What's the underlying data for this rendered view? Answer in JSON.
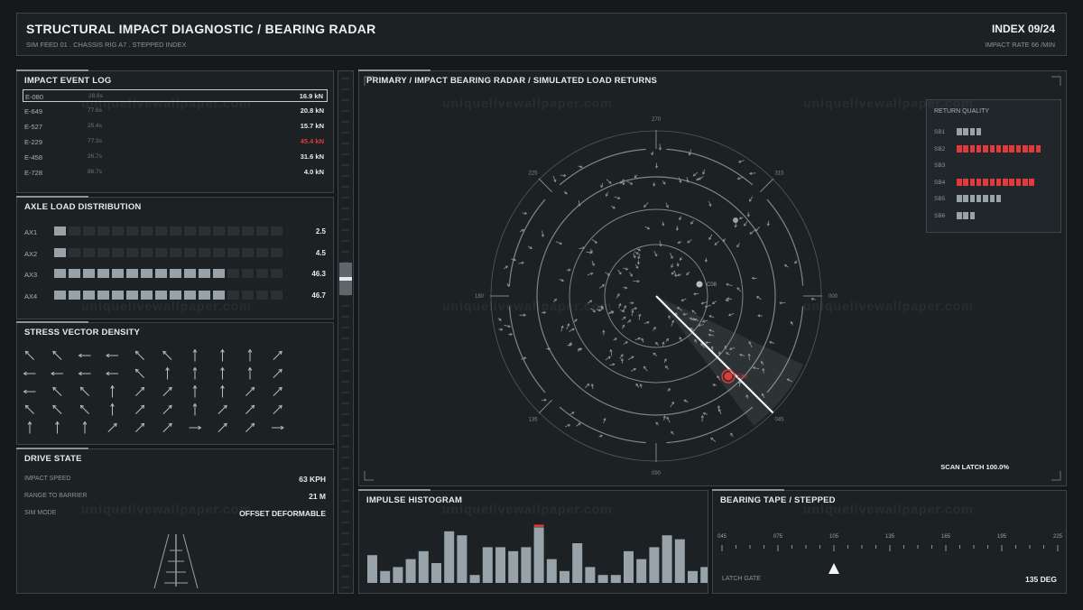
{
  "header": {
    "title": "STRUCTURAL IMPACT DIAGNOSTIC / BEARING RADAR",
    "subtitle": "SIM FEED 01 . CHASSIS RIG A7 . STEPPED INDEX",
    "index": "INDEX 09/24",
    "rate": "IMPACT RATE 66 /MIN"
  },
  "watermark": "uniquelivewallpaper.com",
  "event_log": {
    "title": "IMPACT EVENT LOG",
    "rows": [
      {
        "id": "E-080",
        "time": "28.6s",
        "force": "16.9 kN",
        "alert": false,
        "selected": true
      },
      {
        "id": "E-649",
        "time": "77.6s",
        "force": "20.8 kN",
        "alert": false,
        "selected": false
      },
      {
        "id": "E-527",
        "time": "25.4s",
        "force": "15.7 kN",
        "alert": false,
        "selected": false
      },
      {
        "id": "E-229",
        "time": "77.3s",
        "force": "45.4 kN",
        "alert": true,
        "selected": false
      },
      {
        "id": "E-458",
        "time": "26.7s",
        "force": "31.6 kN",
        "alert": false,
        "selected": false
      },
      {
        "id": "E-728",
        "time": "86.7s",
        "force": "4.0 kN",
        "alert": false,
        "selected": false
      }
    ]
  },
  "axle_load": {
    "title": "AXLE LOAD DISTRIBUTION",
    "total_segments": 16,
    "rows": [
      {
        "label": "AX1",
        "value": "2.5",
        "filled": 1
      },
      {
        "label": "AX2",
        "value": "4.5",
        "filled": 1
      },
      {
        "label": "AX3",
        "value": "46.3",
        "filled": 12
      },
      {
        "label": "AX4",
        "value": "46.7",
        "filled": 12
      }
    ]
  },
  "stress_density": {
    "title": "STRESS VECTOR DENSITY",
    "angles_deg": [
      [
        225,
        225,
        180,
        180,
        225,
        225,
        270,
        270,
        270,
        315
      ],
      [
        180,
        180,
        180,
        180,
        225,
        270,
        270,
        270,
        270,
        315
      ],
      [
        180,
        225,
        225,
        270,
        315,
        315,
        270,
        270,
        315,
        315
      ],
      [
        225,
        225,
        225,
        270,
        315,
        315,
        270,
        315,
        315,
        315
      ],
      [
        270,
        270,
        270,
        315,
        315,
        315,
        0,
        315,
        315,
        0
      ]
    ]
  },
  "drive_state": {
    "title": "DRIVE STATE",
    "rows": [
      {
        "label": "IMPACT SPEED",
        "value": "63 KPH"
      },
      {
        "label": "RANGE TO BARRIER",
        "value": "21 M"
      },
      {
        "label": "SIM MODE",
        "value": "OFFSET DEFORMABLE"
      }
    ]
  },
  "side_slider": {
    "level": 0.55
  },
  "radar": {
    "title": "PRIMARY / IMPACT BEARING RADAR / SIMULATED LOAD RETURNS",
    "bearing_labels": [
      "270",
      "315",
      "000",
      "045",
      "090",
      "135",
      "180",
      "225"
    ],
    "sweep_bearing_deg": 45,
    "target_a_label": "C08",
    "target_b_label": "E80",
    "latch": "SCAN LATCH 100.0%",
    "colors": {
      "alert": "#e03a3a",
      "accent": "#8a9aa3"
    }
  },
  "return_quality": {
    "title": "RETURN QUALITY",
    "rows": [
      {
        "label": "SB1",
        "count": 4,
        "alert": false
      },
      {
        "label": "SB2",
        "count": 13,
        "alert": true
      },
      {
        "label": "SB3",
        "count": 0,
        "alert": false
      },
      {
        "label": "SB4",
        "count": 12,
        "alert": true
      },
      {
        "label": "SB5",
        "count": 7,
        "alert": false
      },
      {
        "label": "SB6",
        "count": 3,
        "alert": false
      }
    ]
  },
  "histogram": {
    "title": "IMPULSE HISTOGRAM",
    "values": [
      7,
      3,
      4,
      6,
      8,
      5,
      13,
      12,
      2,
      9,
      9,
      8,
      9,
      14,
      6,
      3,
      10,
      4,
      2,
      2,
      8,
      6,
      9,
      12,
      11,
      3,
      4
    ],
    "highlight_index": 13,
    "max": 15
  },
  "bearing_tape": {
    "title": "BEARING TAPE / STEPPED",
    "ticks": [
      "045",
      "075",
      "105",
      "135",
      "165",
      "195",
      "225"
    ],
    "pointer_bearing": 105,
    "gate_label": "LATCH GATE",
    "value": "135 DEG"
  }
}
